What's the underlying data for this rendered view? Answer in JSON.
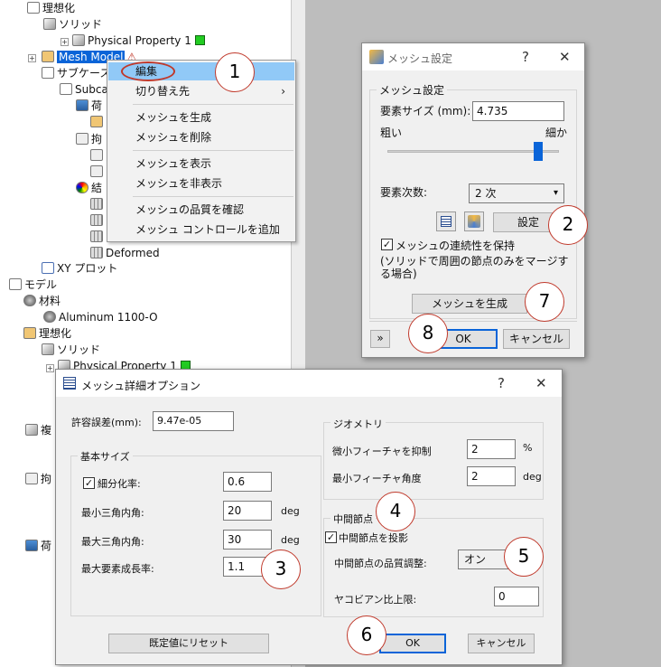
{
  "tree": {
    "idealization_top": "理想化",
    "solid_top": "ソリッド",
    "physical_property_top": "Physical Property 1",
    "mesh_model": "Mesh Model",
    "subcase": "サブケース",
    "subcase_child": "Subca",
    "load_label": "荷",
    "constraint_label": "拘",
    "result_label": "結",
    "deformed": "Deformed",
    "xy_plot": "XY プロット",
    "model": "モデル",
    "material": "材料",
    "aluminum": "Aluminum 1100-O",
    "idealization": "理想化",
    "solid": "ソリッド",
    "physical_property": "Physical Property 1",
    "composite": "複",
    "constraint2": "拘",
    "load2": "荷"
  },
  "context_menu": {
    "items": [
      {
        "label": "編集"
      },
      {
        "label": "切り替え先",
        "arrow": "›"
      },
      {
        "label": "メッシュを生成"
      },
      {
        "label": "メッシュを削除"
      },
      {
        "label": "メッシュを表示"
      },
      {
        "label": "メッシュを非表示"
      },
      {
        "label": "メッシュの品質を確認"
      },
      {
        "label": "メッシュ コントロールを追加"
      }
    ]
  },
  "mesh_dialog": {
    "title": "メッシュ設定",
    "help": "?",
    "close": "✕",
    "group_label": "メッシュ設定",
    "element_size_label": "要素サイズ (mm):",
    "element_size_value": "4.735",
    "coarse": "粗い",
    "fine": "細か",
    "slider_level": 0.88,
    "element_order_label": "要素次数:",
    "element_order_value": "2 次",
    "settings_button": "設定",
    "keep_continuity": "メッシュの連続性を保持",
    "keep_continuity_note": "(ソリッドで周囲の節点のみをマージする場合)",
    "generate_button": "メッシュを生成",
    "ok": "OK",
    "cancel": "キャンセル",
    "collapse": "»"
  },
  "advanced_dialog": {
    "title": "メッシュ詳細オプション",
    "help": "?",
    "close": "✕",
    "tolerance_label": "許容誤差(mm):",
    "tolerance_value": "9.47e-05",
    "basic_size_group": "基本サイズ",
    "refine_label": "細分化率:",
    "refine_value": "0.6",
    "min_angle_label": "最小三角内角:",
    "min_angle_value": "20",
    "max_angle_label": "最大三角内角:",
    "max_angle_value": "30",
    "max_aspect_label": "最大要素成長率:",
    "max_aspect_value": "1.1",
    "deg": "deg",
    "geometry_group": "ジオメトリ",
    "suppress_label": "微小フィーチャを抑制",
    "suppress_value": "2",
    "percent": "%",
    "min_feature_angle_label": "最小フィーチャ角度",
    "min_feature_angle_value": "2",
    "midnode_group": "中間節点",
    "project_midnode": "中間節点を投影",
    "midnode_quality_label": "中間節点の品質調整:",
    "midnode_quality_value": "オン",
    "jacobian_label": "ヤコビアン比上限:",
    "jacobian_value": "0",
    "reset_button": "既定値にリセット",
    "ok": "OK",
    "cancel": "キャンセル"
  },
  "callouts": [
    "1",
    "2",
    "3",
    "4",
    "5",
    "6",
    "7",
    "8"
  ]
}
